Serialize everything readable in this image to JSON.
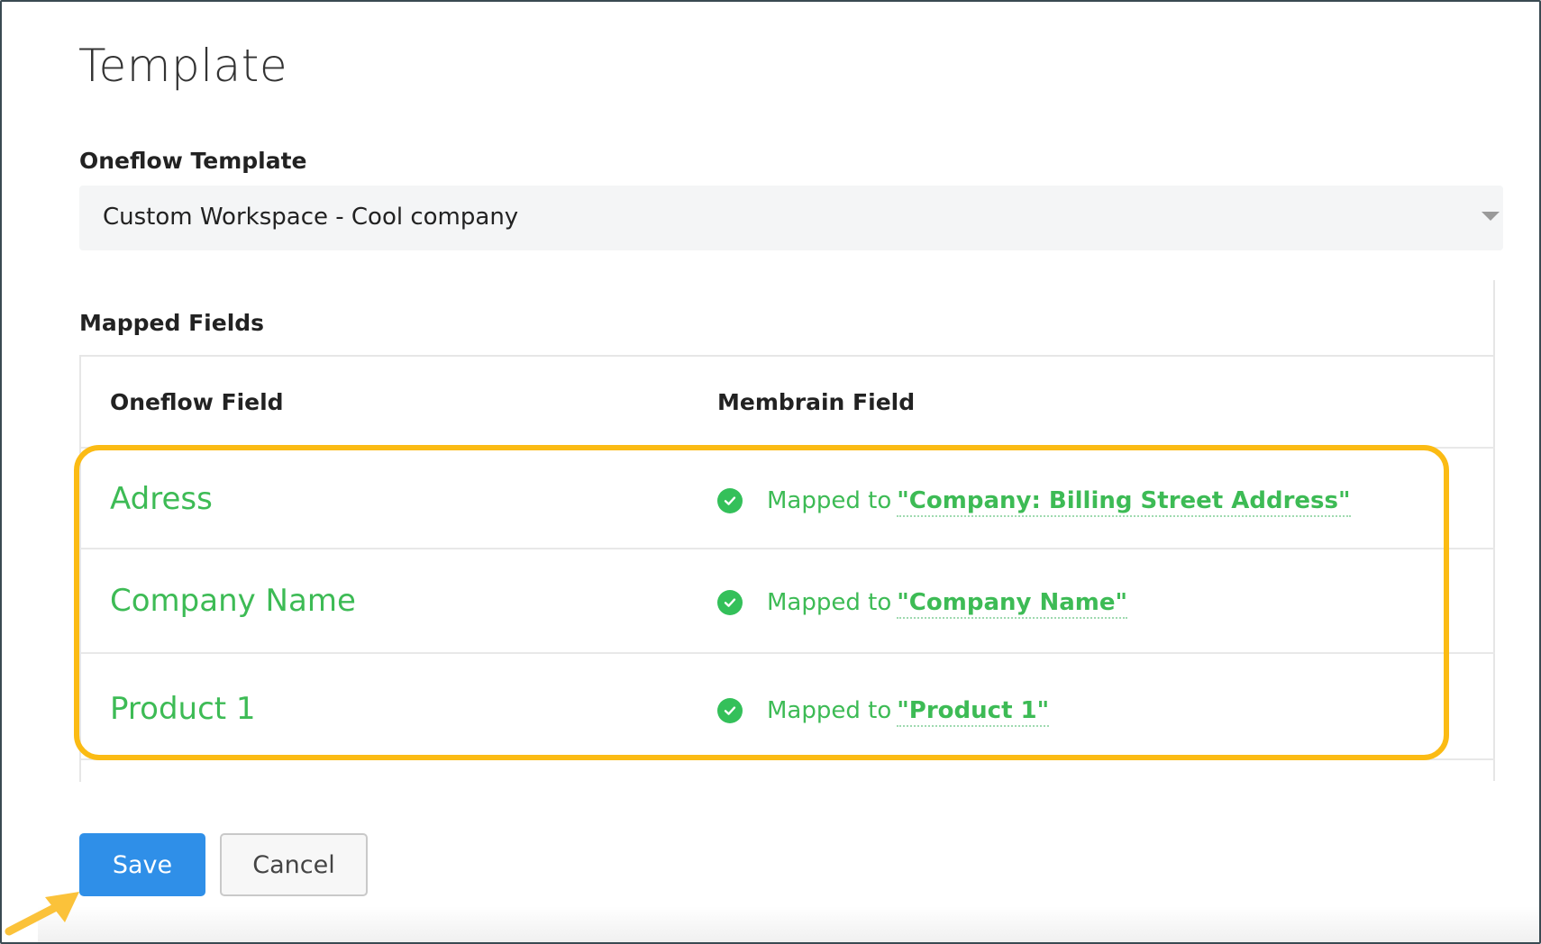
{
  "page": {
    "title": "Template"
  },
  "template_select": {
    "label": "Oneflow Template",
    "value": "Custom Workspace - Cool company"
  },
  "mapped_fields": {
    "label": "Mapped Fields",
    "columns": [
      "Oneflow Field",
      "Membrain Field"
    ],
    "rows": [
      {
        "oneflow_field": "Adress",
        "status_prefix": "Mapped to",
        "membrain_field": "\"Company: Billing Street Address\""
      },
      {
        "oneflow_field": "Company Name",
        "status_prefix": "Mapped to",
        "membrain_field": "\"Company Name\""
      },
      {
        "oneflow_field": "Product 1",
        "status_prefix": "Mapped to",
        "membrain_field": "\"Product 1\""
      }
    ]
  },
  "buttons": {
    "save": "Save",
    "cancel": "Cancel"
  },
  "colors": {
    "accent_green": "#3dbb55",
    "primary_blue": "#2f8fe8",
    "highlight_yellow": "#fbbb14"
  },
  "icons": {
    "status": "check-circle-icon",
    "select": "caret-down-icon",
    "annotation": "arrow-icon"
  }
}
